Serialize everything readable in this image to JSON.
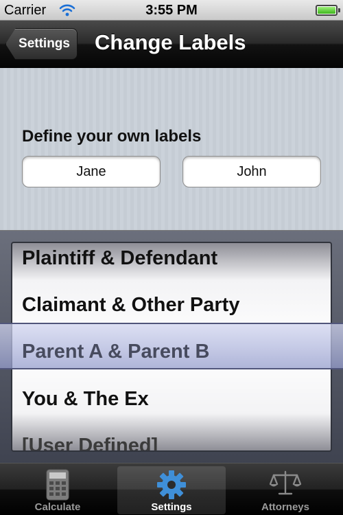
{
  "status_bar": {
    "carrier": "Carrier",
    "time": "3:55 PM"
  },
  "nav": {
    "back_label": "Settings",
    "title": "Change Labels"
  },
  "content": {
    "section_label": "Define your own labels",
    "field_1_value": "Jane",
    "field_2_value": "John"
  },
  "picker": {
    "items": [
      "Plaintiff & Defendant",
      "Claimant & Other Party",
      "Parent A & Parent B",
      "You & The Ex",
      "[User Defined]"
    ],
    "selected": "Parent A & Parent B"
  },
  "tabs": [
    {
      "label": "Calculate",
      "icon": "calculator-icon",
      "active": false
    },
    {
      "label": "Settings",
      "icon": "gear-icon",
      "active": true
    },
    {
      "label": "Attorneys",
      "icon": "scales-icon",
      "active": false
    }
  ],
  "colors": {
    "selected_tab_icon": "#3f8fd8",
    "battery": "#3db51b"
  }
}
